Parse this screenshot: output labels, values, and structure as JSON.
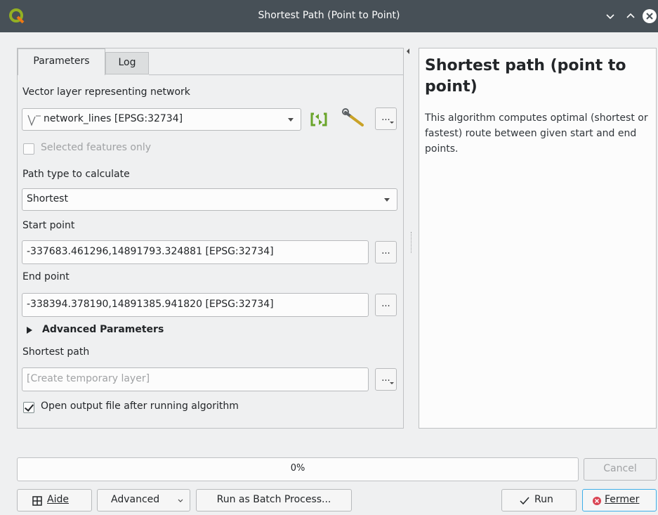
{
  "window": {
    "title": "Shortest Path (Point to Point)",
    "controls": [
      "chevron-down-icon",
      "chevron-up-icon",
      "close-icon"
    ]
  },
  "tabs": [
    {
      "label": "Parameters",
      "active": true
    },
    {
      "label": "Log",
      "active": false
    }
  ],
  "params": {
    "network_label": "Vector layer representing network",
    "network_value": "network_lines [EPSG:32734]",
    "selected_only_label": "Selected features only",
    "path_type_label": "Path type to calculate",
    "path_type_value": "Shortest",
    "start_label": "Start point",
    "start_value": "-337683.461296,14891793.324881 [EPSG:32734]",
    "end_label": "End point",
    "end_value": "-338394.378190,14891385.941820 [EPSG:32734]",
    "advanced_label": "Advanced Parameters",
    "output_label": "Shortest path",
    "output_placeholder": "[Create temporary layer]",
    "open_output_label": "Open output file after running algorithm",
    "dots_label": "..."
  },
  "help": {
    "title": "Shortest path (point to point)",
    "text": "This algorithm computes optimal (shortest or fastest) route between given start and end points."
  },
  "footer": {
    "progress_text": "0%",
    "progress_value": 0,
    "cancel_label": "Cancel",
    "help_label": "Aide",
    "advanced_label": "Advanced",
    "batch_label": "Run as Batch Process...",
    "run_label": "Run",
    "close_label": "Fermer"
  },
  "colors": {
    "titlebar": "#475057",
    "accent": "#3daee9",
    "qgis_green": "#93b023",
    "close_red": "#da4453"
  }
}
